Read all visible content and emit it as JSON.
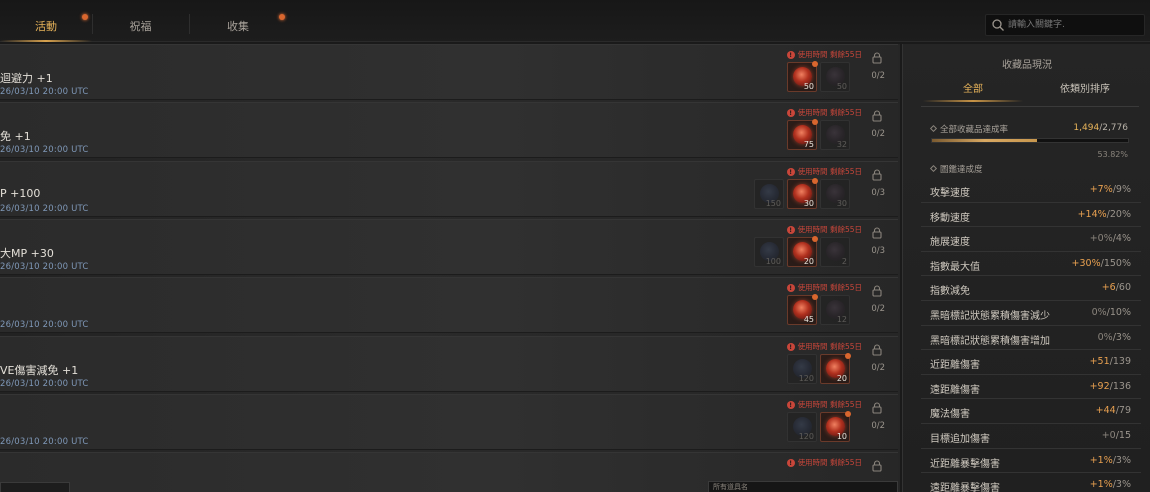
{
  "tabs": [
    {
      "label": "活動",
      "active": true,
      "badge": true
    },
    {
      "label": "祝福",
      "active": false,
      "badge": false
    },
    {
      "label": "收集",
      "active": false,
      "badge": true
    }
  ],
  "search": {
    "placeholder": "請輸入關鍵字."
  },
  "rows": [
    {
      "title": "迴避力 +1",
      "date": "26/03/10 20:00 UTC",
      "warning": "使用時間 剩餘55日",
      "count": "0/2",
      "slots": [
        {
          "kind": "red",
          "num": "50",
          "active": true,
          "badge": true
        },
        {
          "kind": "dark",
          "num": "50",
          "active": false,
          "badge": false
        }
      ]
    },
    {
      "title": "免 +1",
      "date": "26/03/10 20:00 UTC",
      "warning": "使用時間 剩餘55日",
      "count": "0/2",
      "slots": [
        {
          "kind": "red",
          "num": "75",
          "active": true,
          "badge": true
        },
        {
          "kind": "dark",
          "num": "32",
          "active": false,
          "badge": false
        }
      ]
    },
    {
      "title": "P +100",
      "date": "26/03/10 20:00 UTC",
      "warning": "使用時間 剩餘55日",
      "count": "0/3",
      "slots": [
        {
          "kind": "blue",
          "num": "150",
          "active": false,
          "badge": false
        },
        {
          "kind": "red",
          "num": "30",
          "active": true,
          "badge": true
        },
        {
          "kind": "dark",
          "num": "30",
          "active": false,
          "badge": false
        }
      ]
    },
    {
      "title": "大MP +30",
      "date": "26/03/10 20:00 UTC",
      "warning": "使用時間 剩餘55日",
      "count": "0/3",
      "slots": [
        {
          "kind": "blue",
          "num": "100",
          "active": false,
          "badge": false
        },
        {
          "kind": "red",
          "num": "20",
          "active": true,
          "badge": true
        },
        {
          "kind": "dark",
          "num": "2",
          "active": false,
          "badge": false
        }
      ]
    },
    {
      "title": "",
      "date": "26/03/10 20:00 UTC",
      "warning": "使用時間 剩餘55日",
      "count": "0/2",
      "slots": [
        {
          "kind": "red",
          "num": "45",
          "active": true,
          "badge": true
        },
        {
          "kind": "dark",
          "num": "12",
          "active": false,
          "badge": false
        }
      ]
    },
    {
      "title": "VE傷害減免 +1",
      "date": "26/03/10 20:00 UTC",
      "warning": "使用時間 剩餘55日",
      "count": "0/2",
      "slots": [
        {
          "kind": "blue",
          "num": "120",
          "active": false,
          "badge": false
        },
        {
          "kind": "red",
          "num": "20",
          "active": true,
          "badge": true
        }
      ]
    },
    {
      "title": "",
      "date": "26/03/10 20:00 UTC",
      "warning": "使用時間 剩餘55日",
      "count": "0/2",
      "slots": [
        {
          "kind": "blue",
          "num": "120",
          "active": false,
          "badge": false
        },
        {
          "kind": "red",
          "num": "10",
          "active": true,
          "badge": true
        }
      ]
    },
    {
      "title": "",
      "date": "",
      "warning": "使用時間 剩餘55日",
      "count": "",
      "slots": []
    }
  ],
  "bottom_mid_text": "所有道具名",
  "panel": {
    "title": "收藏品現況",
    "tabs": [
      {
        "label": "全部",
        "active": true
      },
      {
        "label": "依類別排序",
        "active": false
      }
    ],
    "rate_label": "全部收藏品達成率",
    "rate_current": "1,494",
    "rate_total": "/2,776",
    "rate_fraction": 0.5382,
    "rate_percent": "53.82%",
    "sub_label": "圖鑑達成度",
    "stats": [
      {
        "name": "攻擊速度",
        "current": "+7%",
        "max": "/9%"
      },
      {
        "name": "移動速度",
        "current": "+14%",
        "max": "/20%"
      },
      {
        "name": "施展速度",
        "current": "+0%",
        "max": "/4%"
      },
      {
        "name": "指數最大值",
        "current": "+30%",
        "max": "/150%"
      },
      {
        "name": "指數減免",
        "current": "+6",
        "max": "/60"
      },
      {
        "name": "黑暗標記狀態累積傷害減少",
        "current": "0%",
        "max": "/10%"
      },
      {
        "name": "黑暗標記狀態累積傷害增加",
        "current": "0%",
        "max": "/3%"
      },
      {
        "name": "近距離傷害",
        "current": "+51",
        "max": "/139"
      },
      {
        "name": "遠距離傷害",
        "current": "+92",
        "max": "/136"
      },
      {
        "name": "魔法傷害",
        "current": "+44",
        "max": "/79"
      },
      {
        "name": "目標追加傷害",
        "current": "+0",
        "max": "/15"
      },
      {
        "name": "近距離暴擊傷害",
        "current": "+1%",
        "max": "/3%"
      },
      {
        "name": "遠距離暴擊傷害",
        "current": "+1%",
        "max": "/3%"
      }
    ]
  }
}
